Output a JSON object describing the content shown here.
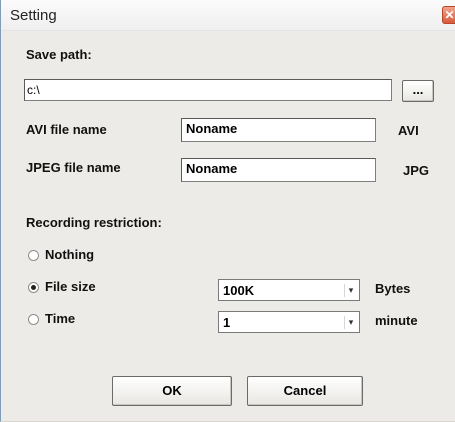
{
  "window": {
    "title": "Setting",
    "close_glyph": "✕"
  },
  "save_path": {
    "label": "Save path:",
    "value": "c:\\",
    "browse_label": "..."
  },
  "avi": {
    "label": "AVI file name",
    "value": "Noname",
    "ext": "AVI"
  },
  "jpeg": {
    "label": "JPEG file name",
    "value": "Noname",
    "ext": "JPG"
  },
  "recording": {
    "label": "Recording restriction:",
    "options": [
      {
        "label": "Nothing",
        "selected": false
      },
      {
        "label": "File size",
        "selected": true
      },
      {
        "label": "Time",
        "selected": false
      }
    ],
    "file_size": {
      "value": "100K",
      "unit": "Bytes"
    },
    "time": {
      "value": "1",
      "unit": "minute"
    }
  },
  "buttons": {
    "ok": "OK",
    "cancel": "Cancel"
  }
}
